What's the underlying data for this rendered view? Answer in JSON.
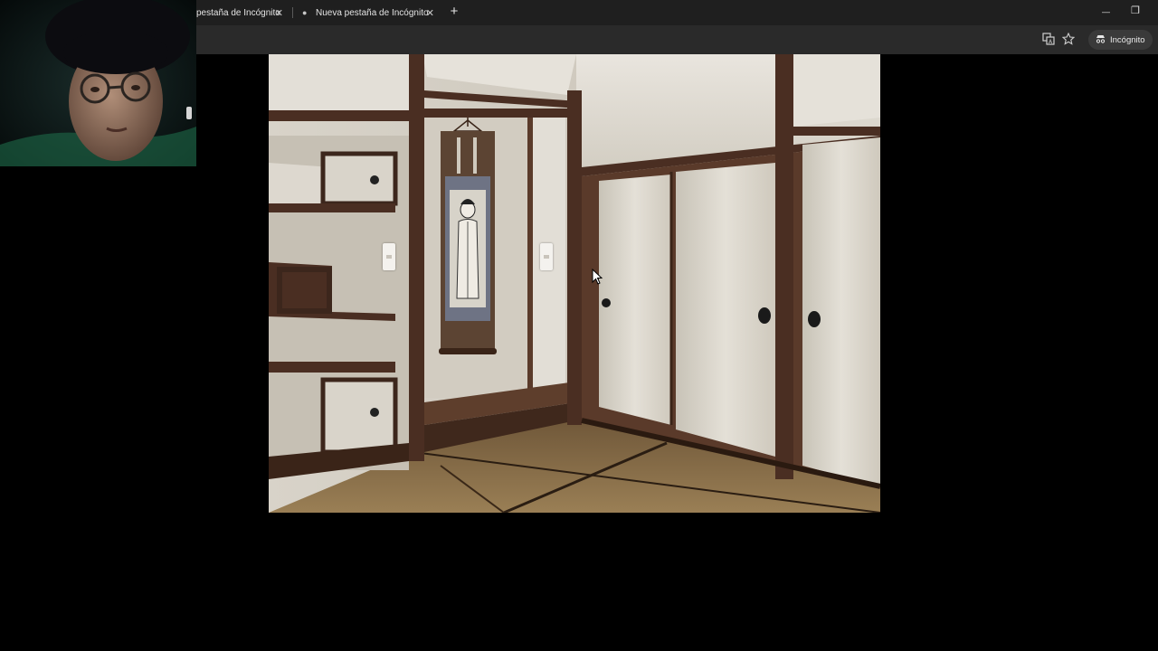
{
  "browser": {
    "tabs": [
      {
        "title": "pestaña de Incógnito",
        "active": false
      },
      {
        "title": "Nueva pestaña de Incógnito",
        "active": true
      }
    ],
    "new_tab_symbol": "+",
    "close_symbol": "✕",
    "window_controls": {
      "minimize": "—",
      "restore": "❐"
    },
    "toolbar": {
      "translate_icon": "translate-icon",
      "bookmark_icon": "star-icon",
      "incognito_label": "Incógnito"
    }
  },
  "webcam": {
    "description_icon": "webcam-overlay"
  },
  "game": {
    "scene": "tatami-room",
    "nav": {
      "left": "turn-left",
      "right": "turn-right"
    }
  },
  "colors": {
    "tabbar": "#1f1f1f",
    "toolbar": "#2a2a2a",
    "wood": "#4a2e22",
    "paper": "#d9d4ca",
    "tatami": "#8a7350"
  }
}
